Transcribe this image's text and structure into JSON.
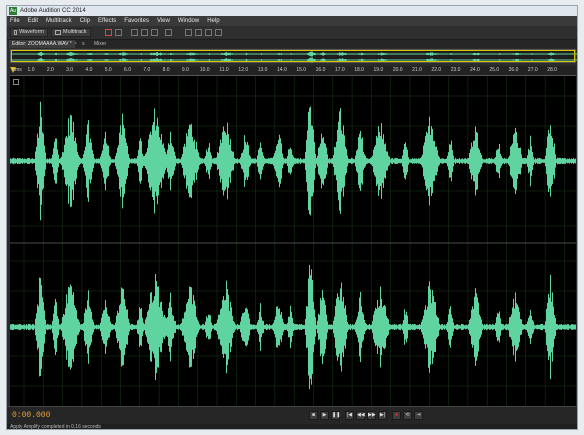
{
  "window": {
    "title": "Adobe Audition CC 2014",
    "logo_text": "Au"
  },
  "menu": [
    "File",
    "Edit",
    "Multitrack",
    "Clip",
    "Effects",
    "Favorites",
    "View",
    "Window",
    "Help"
  ],
  "toolbar": {
    "waveform_label": "Waveform",
    "multitrack_label": "Multitrack"
  },
  "tabs": {
    "editor": "Editor: ZOOMAAAA.WAV *",
    "mixer": "Mixer"
  },
  "ruler": {
    "unit": "hms",
    "ticks": [
      "1.0",
      "2.0",
      "3.0",
      "4.0",
      "5.0",
      "6.0",
      "7.0",
      "8.0",
      "9.0",
      "10.0",
      "11.0",
      "12.0",
      "13.0",
      "14.0",
      "15.0",
      "16.0",
      "17.0",
      "18.0",
      "19.0",
      "20.0",
      "21.0",
      "22.0",
      "23.0",
      "24.0",
      "25.0",
      "26.0",
      "27.0",
      "28.0"
    ]
  },
  "transport": {
    "timecode": "0:00.000"
  },
  "status": {
    "text": "Apply Amplify completed in 0.16 seconds"
  },
  "colors": {
    "waveform": "#5fd3a0",
    "timecode": "#e8a33a",
    "selection": "#d9c400"
  }
}
